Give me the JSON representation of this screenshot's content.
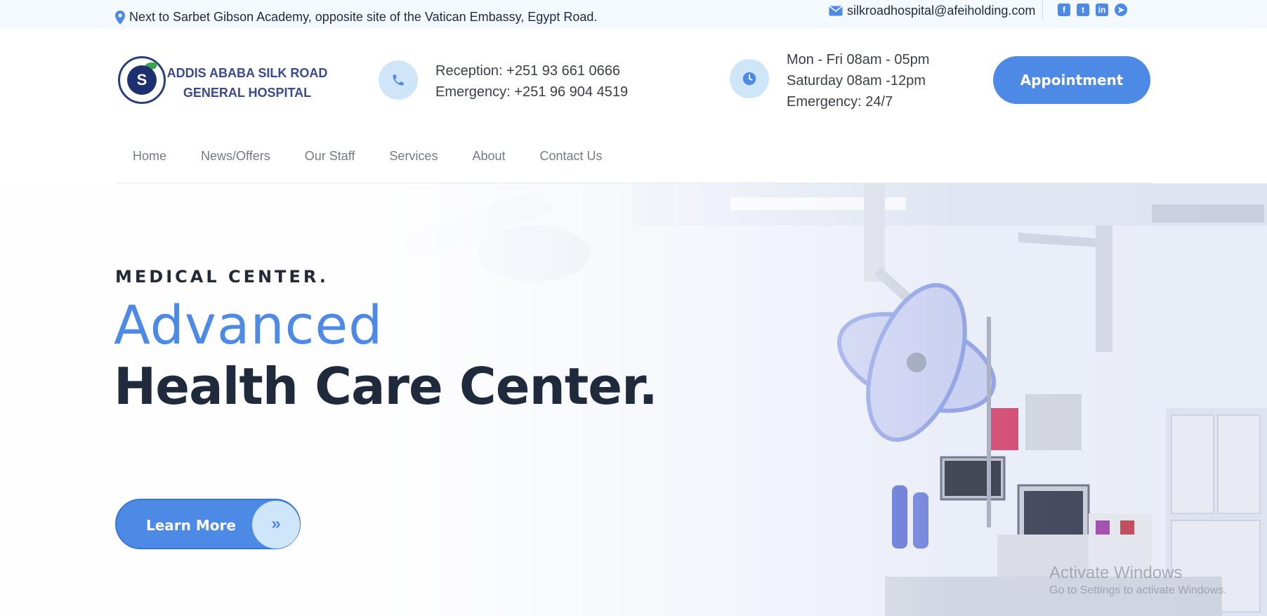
{
  "topbar": {
    "address": "Next to Sarbet Gibson Academy, opposite site of the Vatican Embassy, Egypt Road.",
    "email": "silkroadhospital@afeiholding.com",
    "socials": [
      "facebook-icon",
      "twitter-icon",
      "linkedin-icon",
      "telegram-icon"
    ]
  },
  "header": {
    "hospital_name_line1": "ADDIS ABABA SILK ROAD",
    "hospital_name_line2": "GENERAL HOSPITAL",
    "reception": "Reception: +251 93 661 0666",
    "emergency_phone": "Emergency: +251 96 904 4519",
    "hours_weekday": "Mon - Fri 08am - 05pm",
    "hours_saturday": "Saturday 08am -12pm",
    "hours_emergency": "Emergency: 24/7",
    "appointment_label": "Appointment"
  },
  "nav": {
    "items": [
      "Home",
      "News/Offers",
      "Our Staff",
      "Services",
      "About",
      "Contact Us"
    ]
  },
  "hero": {
    "kicker": "MEDICAL CENTER.",
    "headline_1": "Advanced",
    "headline_2": "Health Care Center.",
    "cta_label": "Learn More"
  },
  "watermark": {
    "title": "Activate Windows",
    "subtitle": "Go to Settings to activate Windows."
  },
  "colors": {
    "accent": "#4d8ae6",
    "accent_light": "#cfe6f8",
    "heading_dark": "#1f2b3d",
    "topbar_bg": "#f4f9fd"
  }
}
